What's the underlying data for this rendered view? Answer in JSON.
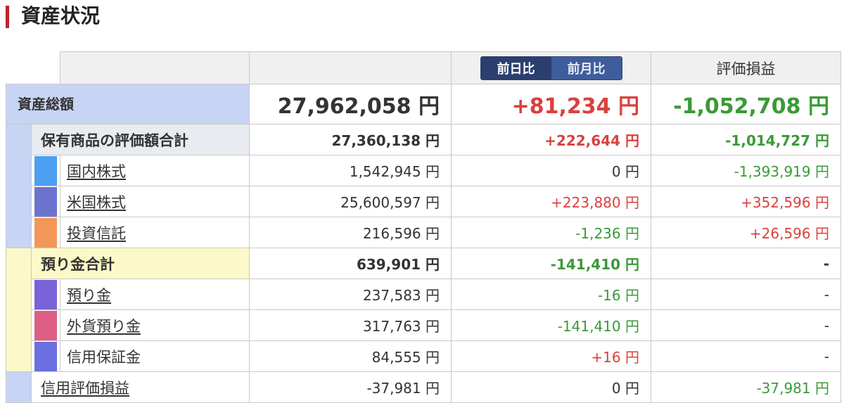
{
  "page": {
    "title": "資産状況"
  },
  "header": {
    "toggle_day": "前日比",
    "toggle_month": "前月比",
    "eval_label": "評価損益"
  },
  "colors": {
    "accent": "#b8262d",
    "positive": "#d9413e",
    "negative": "#3a9a37",
    "band_blue": "#c7d4f3",
    "band_yellow": "#fbf9c8"
  },
  "total": {
    "label": "資産総額",
    "value": "27,962,058 円",
    "day": "+81,234 円",
    "eval": "-1,052,708 円"
  },
  "holdings": {
    "label": "保有商品の評価額合計",
    "value": "27,360,138 円",
    "day": "+222,644 円",
    "eval": "-1,014,727 円",
    "items": [
      {
        "label": "国内株式",
        "color": "#4d9ff3",
        "value": "1,542,945 円",
        "day": "0 円",
        "eval": "-1,393,919 円"
      },
      {
        "label": "米国株式",
        "color": "#6c73cf",
        "value": "25,600,597 円",
        "day": "+223,880 円",
        "eval": "+352,596 円"
      },
      {
        "label": "投資信託",
        "color": "#f2975a",
        "value": "216,596 円",
        "day": "-1,236 円",
        "eval": "+26,596 円"
      }
    ]
  },
  "deposits": {
    "label": "預り金合計",
    "value": "639,901 円",
    "day": "-141,410 円",
    "eval": "-",
    "items": [
      {
        "label": "預り金",
        "color": "#7a62d8",
        "value": "237,583 円",
        "day": "-16 円",
        "eval": "-"
      },
      {
        "label": "外貨預り金",
        "color": "#dd5f86",
        "value": "317,763 円",
        "day": "-141,410 円",
        "eval": "-"
      },
      {
        "label": "信用保証金",
        "color": "#6b6fe0",
        "value": "84,555 円",
        "day": "+16 円",
        "eval": "-"
      }
    ]
  },
  "margin": {
    "label": "信用評価損益",
    "value": "-37,981 円",
    "day": "0 円",
    "eval": "-37,981 円"
  }
}
